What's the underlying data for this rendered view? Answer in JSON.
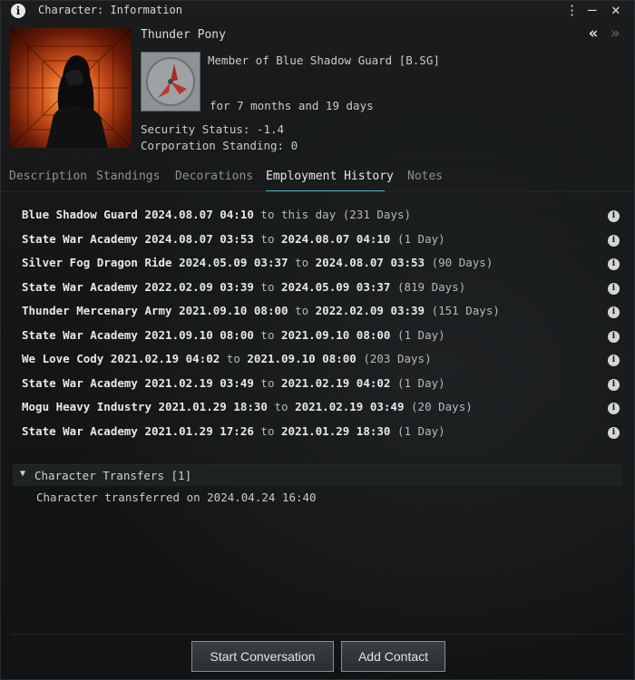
{
  "window": {
    "title": "Character: Information"
  },
  "header": {
    "name": "Thunder Pony",
    "membership": "Member of Blue Shadow Guard [B.SG]",
    "duration": "for 7 months and 19 days",
    "security_status": "Security Status: -1.4",
    "corporation_standing": "Corporation Standing: 0"
  },
  "tabs": [
    {
      "label": "Description"
    },
    {
      "label": "Standings"
    },
    {
      "label": "Decorations"
    },
    {
      "label": "Employment History",
      "active": true
    },
    {
      "label": "Notes"
    }
  ],
  "employment": [
    {
      "corp": "Blue Shadow Guard",
      "start": "2024.08.07 04:10",
      "sep": "to",
      "end": "this day",
      "days": "(231 Days)"
    },
    {
      "corp": "State War Academy",
      "start": "2024.08.07 03:53",
      "sep": "to",
      "end": "2024.08.07 04:10",
      "days": "(1 Day)"
    },
    {
      "corp": "Silver Fog Dragon Ride",
      "start": "2024.05.09 03:37",
      "sep": "to",
      "end": "2024.08.07 03:53",
      "days": "(90 Days)"
    },
    {
      "corp": "State War Academy",
      "start": "2022.02.09 03:39",
      "sep": "to",
      "end": "2024.05.09 03:37",
      "days": "(819 Days)"
    },
    {
      "corp": "Thunder Mercenary Army",
      "start": "2021.09.10 08:00",
      "sep": "to",
      "end": "2022.02.09 03:39",
      "days": "(151 Days)"
    },
    {
      "corp": "State War Academy",
      "start": "2021.09.10 08:00",
      "sep": "to",
      "end": "2021.09.10 08:00",
      "days": "(1 Day)"
    },
    {
      "corp": "We Love Cody",
      "start": "2021.02.19 04:02",
      "sep": "to",
      "end": "2021.09.10 08:00",
      "days": "(203 Days)"
    },
    {
      "corp": "State War Academy",
      "start": "2021.02.19 03:49",
      "sep": "to",
      "end": "2021.02.19 04:02",
      "days": "(1 Day)"
    },
    {
      "corp": "Mogu Heavy Industry",
      "start": "2021.01.29 18:30",
      "sep": "to",
      "end": "2021.02.19 03:49",
      "days": "(20 Days)"
    },
    {
      "corp": "State War Academy",
      "start": "2021.01.29 17:26",
      "sep": "to",
      "end": "2021.01.29 18:30",
      "days": "(1 Day)"
    }
  ],
  "transfers": {
    "title": "Character Transfers [1]",
    "items": [
      "Character transferred on 2024.04.24 16:40"
    ]
  },
  "buttons": {
    "start_conversation": "Start Conversation",
    "add_contact": "Add Contact"
  },
  "icons": {
    "info": "info-icon",
    "menu": "kebab-menu-icon",
    "minimize": "minimize-icon",
    "close": "close-icon",
    "back": "double-chevron-left-icon",
    "forward": "double-chevron-right-icon",
    "caret": "caret-down-icon"
  },
  "colors": {
    "accent": "#54b0c6",
    "background": "#141617",
    "text": "#c9cbcc"
  }
}
